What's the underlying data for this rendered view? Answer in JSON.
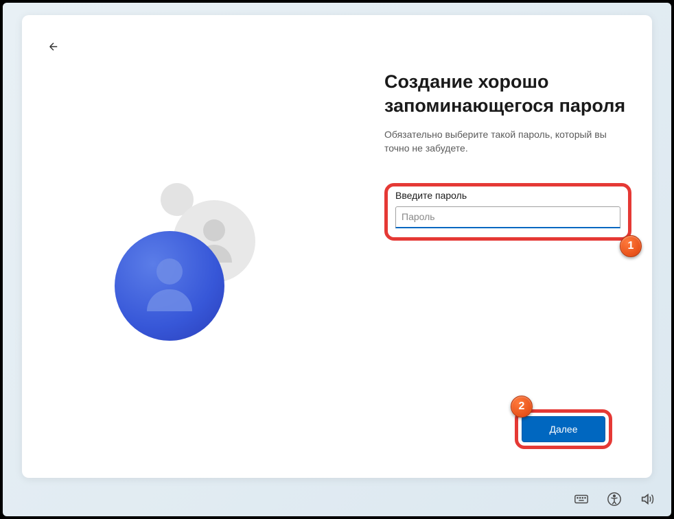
{
  "screen": {
    "title": "Создание хорошо запоминающегося пароля",
    "subtitle": "Обязательно выберите такой пароль, который вы точно не забудете."
  },
  "input": {
    "label": "Введите пароль",
    "placeholder": "Пароль",
    "value": ""
  },
  "buttons": {
    "next": "Далее"
  },
  "annotations": {
    "badge1": "1",
    "badge2": "2"
  }
}
